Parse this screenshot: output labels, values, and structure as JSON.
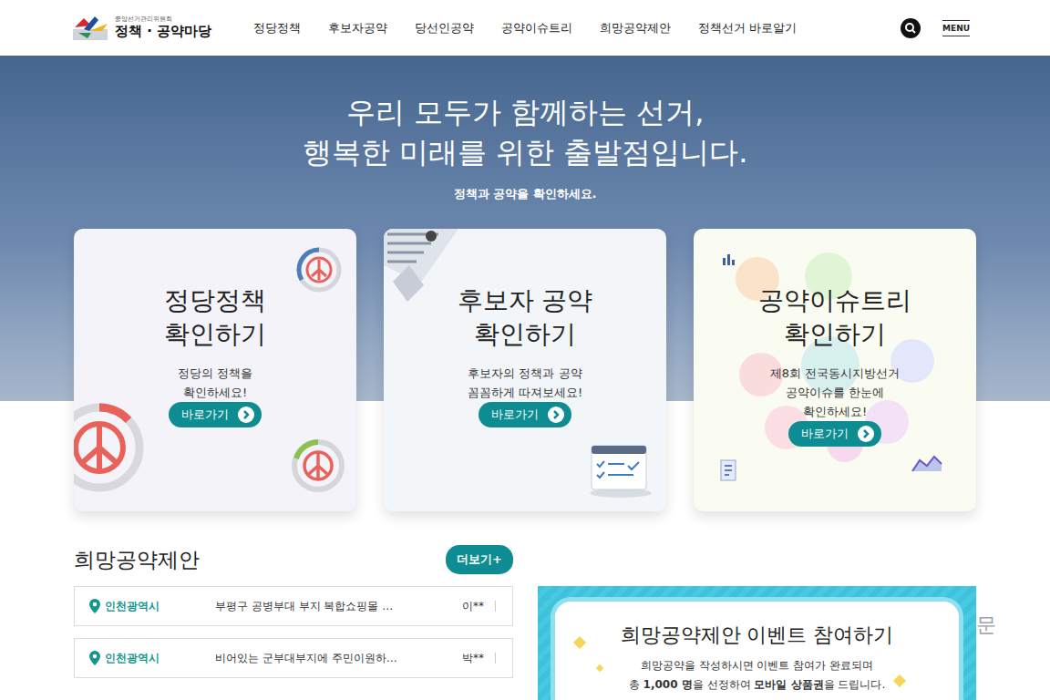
{
  "header": {
    "org": "중앙선거관리위원회",
    "logo": "정책 · 공약마당",
    "nav": [
      "정당정책",
      "후보자공약",
      "당선인공약",
      "공약이슈트리",
      "희망공약제안",
      "정책선거 바로알기"
    ],
    "menu": "MENU"
  },
  "hero": {
    "headline": [
      "우리 모두가 함께하는 선거,",
      "행복한 미래를 위한 출발점입니다."
    ],
    "subtitle": "정책과 공약을 확인하세요."
  },
  "cards": [
    {
      "kind": "party",
      "title": [
        "정당정책",
        "확인하기"
      ],
      "description": [
        "정당의 정책을",
        "확인하세요!"
      ],
      "button": "바로가기"
    },
    {
      "kind": "candidate",
      "title": [
        "후보자 공약",
        "확인하기"
      ],
      "description": [
        "후보자의 정책과 공약",
        "꼼꼼하게 따져보세요!"
      ],
      "button": "바로가기"
    },
    {
      "kind": "issue",
      "title": [
        "공약이슈트리",
        "확인하기"
      ],
      "description": [
        "제8회 전국동시지방선거",
        "공약이슈를 한눈에",
        "확인하세요!"
      ],
      "button": "바로가기"
    }
  ],
  "proposals": {
    "title": "희망공약제안",
    "more": "더보기+",
    "items": [
      {
        "region": "인천광역시",
        "text": "부평구 공병부대 부지 복합쇼핑몰 …",
        "author": "이**"
      },
      {
        "region": "인천광역시",
        "text": "비어있는 군부대부지에 주민이원하…",
        "author": "박**"
      }
    ]
  },
  "event": {
    "title": "희망공약제안 이벤트 참여하기",
    "line": "희망공약을 작성하시면 이벤트 참여가 완료되며",
    "segments": [
      {
        "t": "총 ",
        "bold": false
      },
      {
        "t": "1,000 명",
        "bold": true
      },
      {
        "t": "을 선정하여 ",
        "bold": false
      },
      {
        "t": "모바일 상품권",
        "bold": true
      },
      {
        "t": "을 드립니다.",
        "bold": false
      }
    ]
  },
  "watermark": "문"
}
